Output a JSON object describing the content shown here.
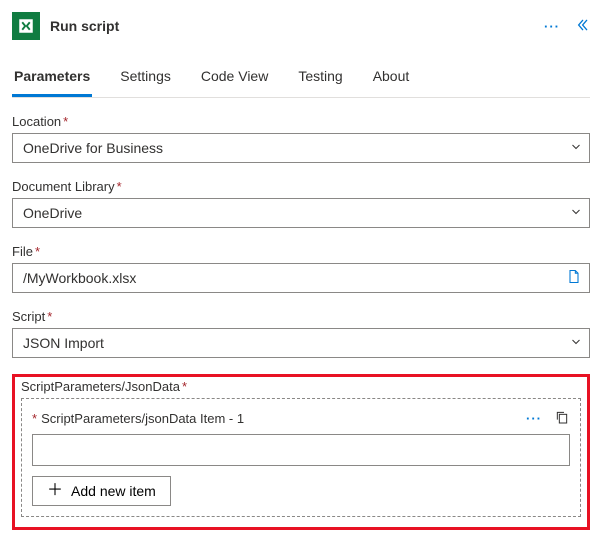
{
  "header": {
    "title": "Run script"
  },
  "tabs": [
    {
      "id": "parameters",
      "label": "Parameters",
      "active": true
    },
    {
      "id": "settings",
      "label": "Settings",
      "active": false
    },
    {
      "id": "codeview",
      "label": "Code View",
      "active": false
    },
    {
      "id": "testing",
      "label": "Testing",
      "active": false
    },
    {
      "id": "about",
      "label": "About",
      "active": false
    }
  ],
  "fields": {
    "location": {
      "label": "Location",
      "required": true,
      "value": "OneDrive for Business"
    },
    "documentLibrary": {
      "label": "Document Library",
      "required": true,
      "value": "OneDrive"
    },
    "file": {
      "label": "File",
      "required": true,
      "value": "/MyWorkbook.xlsx"
    },
    "script": {
      "label": "Script",
      "required": true,
      "value": "JSON Import"
    }
  },
  "jsonData": {
    "label": "ScriptParameters/JsonData",
    "required": true,
    "items": [
      {
        "title": "ScriptParameters/jsonData Item - 1",
        "value": ""
      }
    ],
    "addLabel": "Add new item"
  },
  "requiredMarker": "*"
}
